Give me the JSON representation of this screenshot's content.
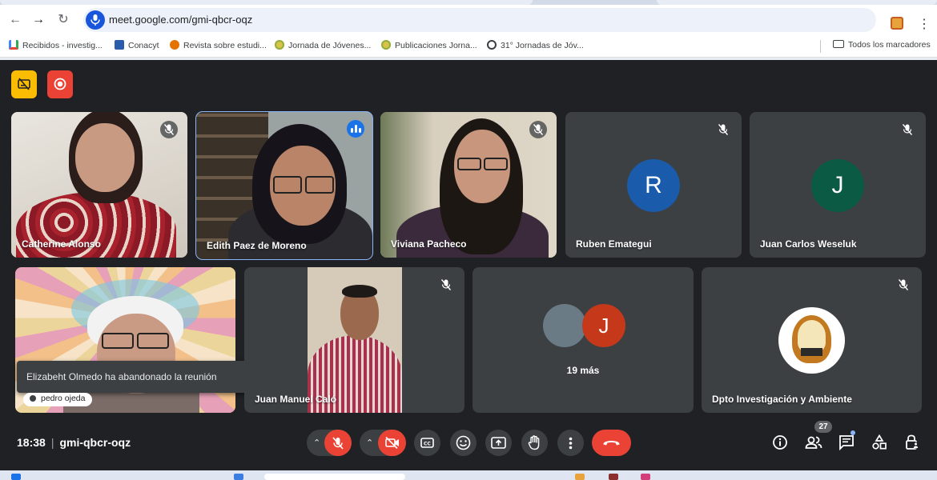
{
  "browser": {
    "url": "meet.google.com/gmi-qbcr-oqz",
    "bookmarks": [
      {
        "label": "Recibidos - investig...",
        "icon": "gmail-icon",
        "color": "#ea4335"
      },
      {
        "label": "Conacyt",
        "icon": "conacyt-icon",
        "color": "#2b5cab"
      },
      {
        "label": "Revista sobre estudi...",
        "icon": "journal-icon",
        "color": "#e37400"
      },
      {
        "label": "Jornada de Jóvenes...",
        "icon": "sun-icon",
        "color": "#8fb03a"
      },
      {
        "label": "Publicaciones Jorna...",
        "icon": "sun-icon",
        "color": "#8fb03a"
      },
      {
        "label": "31° Jornadas de Jóv...",
        "icon": "globe-icon",
        "color": "#3c4043"
      }
    ],
    "all_bookmarks": "Todos los marcadores"
  },
  "meeting": {
    "time": "18:38",
    "code": "gmi-qbcr-oqz",
    "participant_count": "27",
    "toast": "Elizabeht Olmedo ha abandonado la reunión",
    "presenter_chip": "pedro ojeda",
    "more_label": "19 más",
    "tiles": [
      {
        "name": "Catherine Alonso"
      },
      {
        "name": "Edith Paez de Moreno"
      },
      {
        "name": "Viviana Pacheco"
      },
      {
        "name": "Ruben Emategui",
        "initial": "R",
        "color": "#1a5bab"
      },
      {
        "name": "Juan Carlos Weseluk",
        "initial": "J",
        "color": "#0b5a43"
      },
      {
        "name": ""
      },
      {
        "name": "Juan Manuel Caló"
      },
      {
        "name": "",
        "initial": "J",
        "color": "#c5391a"
      },
      {
        "name": "Dpto Investigación y Ambiente"
      }
    ]
  },
  "colors": {
    "end_call": "#ea4335",
    "mic_off": "#ea4335",
    "accent": "#8ab4f8"
  }
}
